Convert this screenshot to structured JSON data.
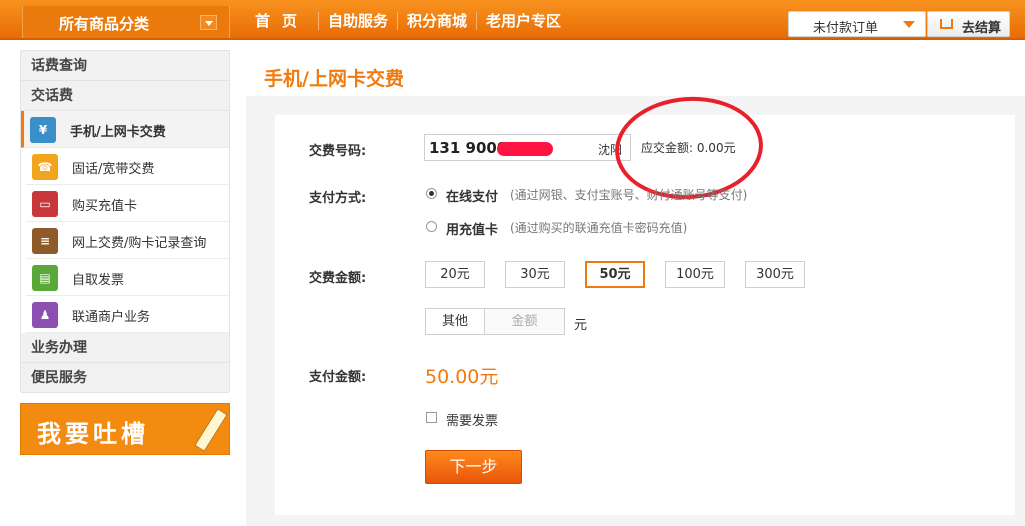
{
  "header": {
    "category_title": "所有商品分类",
    "nav": [
      "首页",
      "自助服务",
      "积分商城",
      "老用户专区"
    ],
    "order_select": "未付款订单",
    "checkout_label": "去结算"
  },
  "sidebar": {
    "groups": {
      "query": "话费查询",
      "pay": "交话费",
      "business": "业务办理",
      "convenience": "便民服务"
    },
    "items": [
      {
        "label": "手机/上网卡交费",
        "icon": "mobile-icon",
        "color": "#3a8fc8",
        "glyph": "¥"
      },
      {
        "label": "固话/宽带交费",
        "icon": "telephone-icon",
        "color": "#f2a51c",
        "glyph": "☎"
      },
      {
        "label": "购买充值卡",
        "icon": "card-icon",
        "color": "#c8373c",
        "glyph": "▭"
      },
      {
        "label": "网上交费/购卡记录查询",
        "icon": "record-icon",
        "color": "#8f5a2a",
        "glyph": "≡"
      },
      {
        "label": "自取发票",
        "icon": "invoice-icon",
        "color": "#5aa83a",
        "glyph": "▤"
      },
      {
        "label": "联通商户业务",
        "icon": "merchant-icon",
        "color": "#8a4fb0",
        "glyph": "♟"
      }
    ],
    "banner": "我要吐槽"
  },
  "main": {
    "title": "手机/上网卡交费",
    "phone_label": "交费号码:",
    "phone_number": "131 9009",
    "phone_city": "沈阳",
    "due_text": "应交金额: 0.00元",
    "pay_method_label": "支付方式:",
    "pay_methods": [
      {
        "label": "在线支付",
        "note": "(通过网银、支付宝账号、财付通账号等支付)"
      },
      {
        "label": "用充值卡",
        "note": "(通过购买的联通充值卡密码充值)"
      }
    ],
    "amount_label": "交费金额:",
    "amounts": [
      "20元",
      "30元",
      "50元",
      "100元",
      "300元"
    ],
    "selected_amount": "50元",
    "other_label": "其他",
    "amount_placeholder": "金额",
    "unit": "元",
    "pay_total_label": "支付金额:",
    "pay_total": "50.00元",
    "invoice_label": "需要发票",
    "next_label": "下一步"
  },
  "colors": {
    "accent": "#f07a10",
    "annotation_circle": "#e8202c"
  }
}
